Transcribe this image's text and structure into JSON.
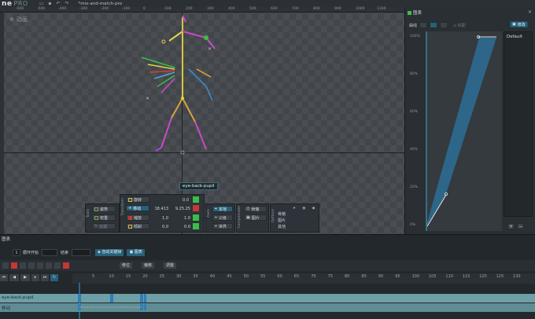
{
  "app": {
    "logo_main": "ne",
    "logo_pro": "PRO",
    "file_title": "*mix-and-match-pro"
  },
  "viewport": {
    "title": "动画",
    "ruler_top": [
      "-600",
      "-500",
      "-400",
      "-300",
      "-200",
      "-100",
      "0",
      "100",
      "200",
      "300",
      "400",
      "500",
      "600",
      "700",
      "800",
      "900",
      "1000",
      "1100"
    ],
    "bone_tooltip": "eye-back-pupil"
  },
  "tools": {
    "label": "Tools",
    "pose": "姿势",
    "weights": "权重",
    "create": "创建"
  },
  "transform": {
    "label": "Transform",
    "rotate": "旋转",
    "rotate_val": "0.0",
    "translate": "移动",
    "translate_x": "18.413",
    "translate_y": "9.25.25",
    "scale": "缩放",
    "scale_x": "1.0",
    "scale_y": "1.0",
    "shear": "倾斜",
    "shear_x": "0.0",
    "shear_y": "0.0"
  },
  "axes": {
    "label": "Axes",
    "local": "本地",
    "parent": "父级",
    "world": "世界"
  },
  "compensate": {
    "label": "Compensate",
    "bones": "骨骼",
    "images": "图片"
  },
  "options": {
    "label": "Options",
    "rows": [
      "骨骼",
      "图片",
      "其他"
    ]
  },
  "graph": {
    "tab": "图表",
    "curve_label": "曲线",
    "match_label": "匹配",
    "mod_label": "修改",
    "y_ticks": [
      "100%",
      "80%",
      "60%",
      "40%",
      "20%",
      "0%"
    ],
    "list_item": "Default"
  },
  "timeline": {
    "tab": "图表",
    "frame_input": "1",
    "loop_start": "循环开始",
    "end_label": "结束",
    "auto_key": "自动关键帧",
    "graph_btn": "图表",
    "toolbar2": [
      "移位",
      "偏移",
      "调整"
    ],
    "ticks": [
      "5",
      "10",
      "15",
      "20",
      "25",
      "30",
      "35",
      "40",
      "45",
      "50",
      "55",
      "60",
      "65",
      "70",
      "75",
      "80",
      "85",
      "90",
      "95",
      "100",
      "105",
      "110",
      "115",
      "120",
      "125",
      "130"
    ],
    "track_bone": "eye-back-pupil",
    "track_sub": "移动"
  },
  "colors": {
    "accent": "#27607a",
    "track": "#6e9ea6",
    "key_blue": "#3aa0d8"
  }
}
